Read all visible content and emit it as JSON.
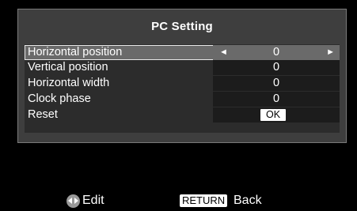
{
  "panel": {
    "title": "PC Setting"
  },
  "rows": [
    {
      "label": "Horizontal position",
      "value": "0"
    },
    {
      "label": "Vertical position",
      "value": "0"
    },
    {
      "label": "Horizontal width",
      "value": "0"
    },
    {
      "label": "Clock phase",
      "value": "0"
    },
    {
      "label": "Reset",
      "value": "OK"
    }
  ],
  "arrows": {
    "left": "◄",
    "right": "►"
  },
  "footer": {
    "edit_icon": "dpad-left-right-icon",
    "edit_label": "Edit",
    "return_key": "RETURN",
    "back_label": "Back"
  },
  "colors": {
    "background": "#000000",
    "panel": "#3e3e3e",
    "selected_row": "#6a6a6a",
    "text": "#ffffff"
  }
}
